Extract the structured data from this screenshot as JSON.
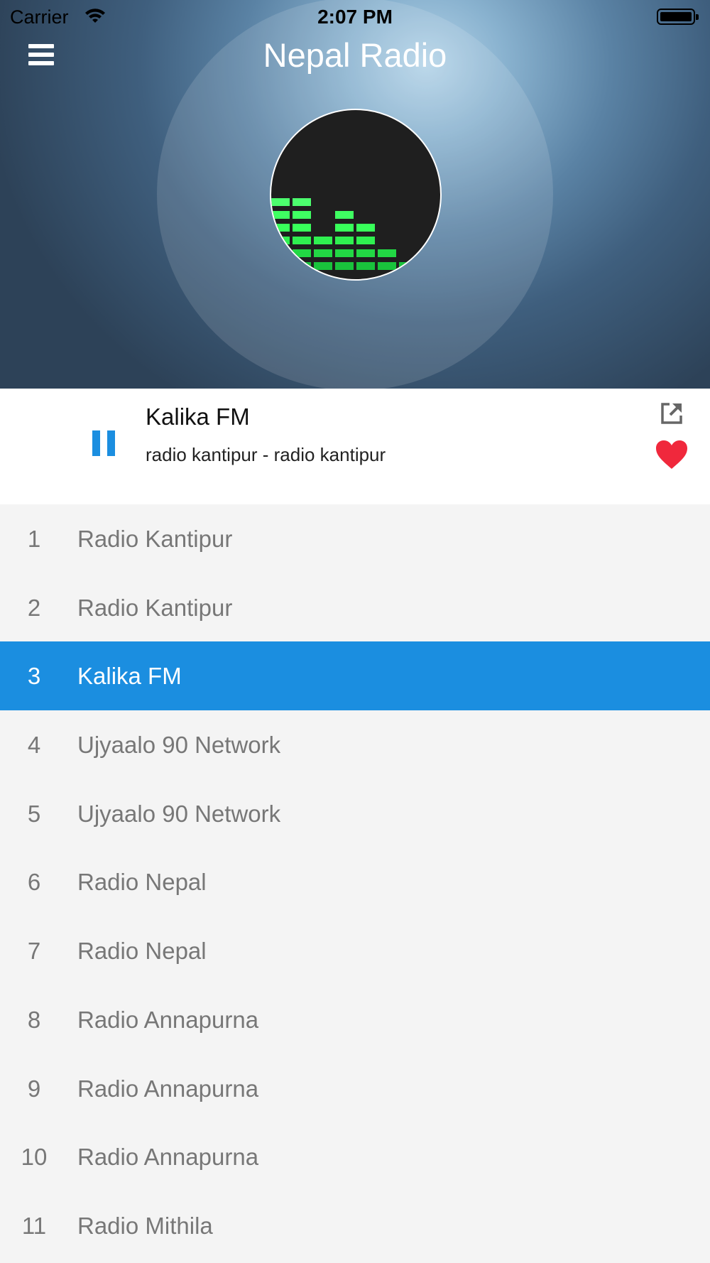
{
  "status_bar": {
    "carrier": "Carrier",
    "time": "2:07 PM"
  },
  "header": {
    "title": "Nepal Radio"
  },
  "now_playing": {
    "station": "Kalika FM",
    "subtitle": "radio kantipur - radio kantipur"
  },
  "colors": {
    "accent": "#1b8ee0",
    "favorite": "#f0283c"
  },
  "stations": [
    {
      "num": "1",
      "name": "Radio Kantipur"
    },
    {
      "num": "2",
      "name": "Radio Kantipur"
    },
    {
      "num": "3",
      "name": "Kalika FM",
      "active": true
    },
    {
      "num": "4",
      "name": "Ujyaalo 90 Network"
    },
    {
      "num": "5",
      "name": "Ujyaalo 90 Network"
    },
    {
      "num": "6",
      "name": "Radio Nepal"
    },
    {
      "num": "7",
      "name": "Radio Nepal"
    },
    {
      "num": "8",
      "name": "Radio Annapurna"
    },
    {
      "num": "9",
      "name": "Radio Annapurna"
    },
    {
      "num": "10",
      "name": "Radio Annapurna"
    },
    {
      "num": "11",
      "name": "Radio Mithila"
    }
  ]
}
